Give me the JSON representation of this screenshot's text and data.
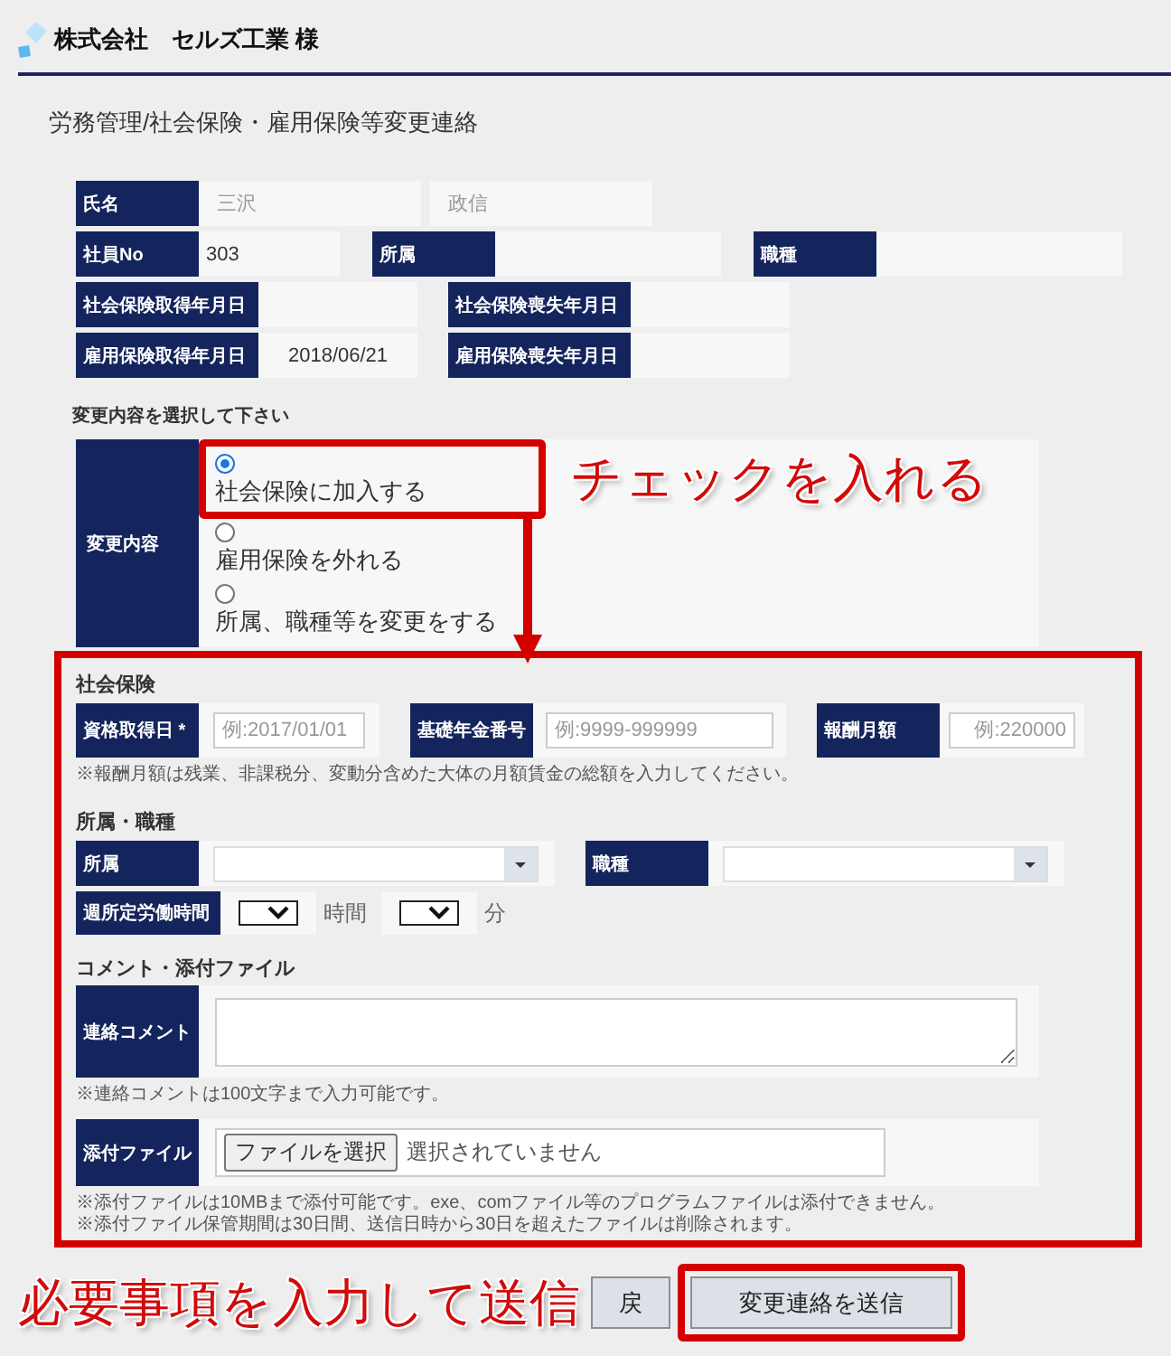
{
  "header": {
    "company": "株式会社　セルズ工業 様"
  },
  "page_title": "労務管理/社会保険・雇用保険等変更連絡",
  "employee_info": [
    [
      {
        "label": "氏名",
        "values": [
          {
            "text": "三沢",
            "muted": true
          },
          {
            "text": "政信",
            "muted": true
          }
        ]
      }
    ],
    [
      {
        "label": "社員No",
        "values": [
          {
            "text": "303",
            "muted": false
          }
        ]
      },
      {
        "label": "所属"
      },
      {
        "label": "職種"
      }
    ],
    [
      {
        "label": "社会保険取得年月日"
      },
      {
        "label": "社会保険喪失年月日"
      }
    ],
    [
      {
        "label": "雇用保険取得年月日",
        "values": [
          {
            "text": "2018/06/21",
            "muted": false
          }
        ]
      },
      {
        "label": "雇用保険喪失年月日"
      }
    ]
  ],
  "change_type": {
    "heading": "変更内容を選択して下さい",
    "label": "変更内容",
    "options": [
      {
        "label": "社会保険に加入する",
        "selected": true,
        "highlighted": true
      },
      {
        "label": "雇用保険を外れる",
        "selected": false,
        "highlighted": false
      },
      {
        "label": "所属、職種等を変更をする",
        "selected": false,
        "highlighted": false
      }
    ]
  },
  "social_insurance": {
    "title": "社会保険",
    "fields": [
      {
        "label": "資格取得日 *",
        "placeholder": "例:2017/01/01"
      },
      {
        "label": "基礎年金番号",
        "placeholder": "例:9999-999999"
      },
      {
        "label": "報酬月額",
        "placeholder": "例:220000"
      }
    ],
    "note": "※報酬月額は残業、非課税分、変動分含めた大体の月額賃金の総額を入力してください。"
  },
  "affiliation": {
    "title": "所属・職種",
    "selects": [
      {
        "label": "所属"
      },
      {
        "label": "職種"
      }
    ],
    "weekly_hours": {
      "label": "週所定労働時間",
      "units": [
        "時間",
        "分"
      ]
    }
  },
  "comment_attachment": {
    "title": "コメント・添付ファイル",
    "comment_label": "連絡コメント",
    "comment_note": "※連絡コメントは100文字まで入力可能です。",
    "attachment_label": "添付ファイル",
    "file_button": "ファイルを選択",
    "file_status": "選択されていません",
    "attachment_notes": [
      "※添付ファイルは10MBまで添付可能です。exe、comファイル等のプログラムファイルは添付できません。",
      "※添付ファイル保管期間は30日間、送信日時から30日を超えたファイルは削除されます。"
    ]
  },
  "buttons": [
    {
      "kind": "back",
      "label": "戻",
      "highlighted": false
    },
    {
      "kind": "submit",
      "label": "変更連絡を送信",
      "highlighted": true
    }
  ],
  "annotations": {
    "check_hint": "チェックを入れる",
    "submit_hint": "必要事項を入力して送信"
  }
}
